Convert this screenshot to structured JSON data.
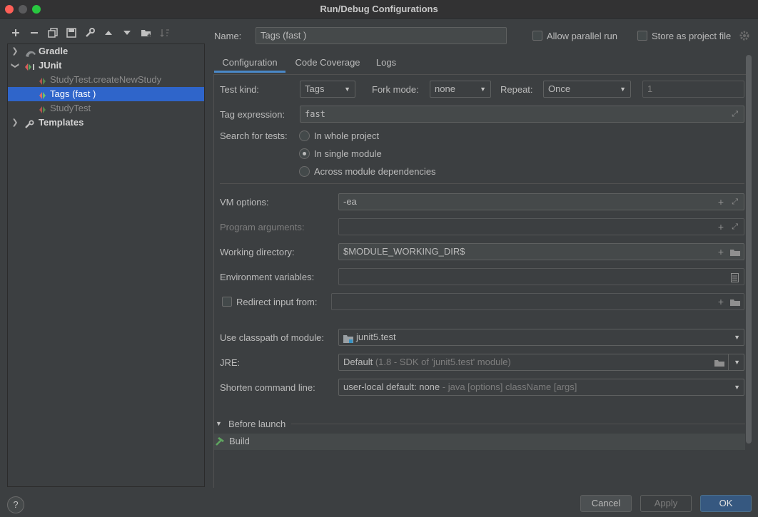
{
  "window": {
    "title": "Run/Debug Configurations"
  },
  "toolbar": {
    "icons": [
      "plus-icon",
      "minus-icon",
      "copy-icon",
      "save-icon",
      "wrench-icon",
      "arrow-up-icon",
      "arrow-down-icon",
      "folder-add-icon",
      "sort-icon"
    ]
  },
  "tree": {
    "items": [
      {
        "label": "Gradle",
        "icon": "gradle-icon",
        "expanded": false
      },
      {
        "label": "JUnit",
        "icon": "junit-icon",
        "expanded": true
      },
      {
        "label": "StudyTest.createNewStudy",
        "icon": "test-icon"
      },
      {
        "label": "Tags (fast )",
        "icon": "test-icon",
        "selected": true
      },
      {
        "label": "StudyTest",
        "icon": "test-icon"
      },
      {
        "label": "Templates",
        "icon": "wrench-icon",
        "expanded": false
      }
    ]
  },
  "header": {
    "name_label": "Name:",
    "name_value": "Tags (fast )",
    "allow_parallel": "Allow parallel run",
    "store_project": "Store as project file"
  },
  "tabs": [
    "Configuration",
    "Code Coverage",
    "Logs"
  ],
  "config": {
    "test_kind_label": "Test kind:",
    "test_kind_value": "Tags",
    "fork_mode_label": "Fork mode:",
    "fork_mode_value": "none",
    "repeat_label": "Repeat:",
    "repeat_value": "Once",
    "repeat_count": "1",
    "tag_expr_label": "Tag expression:",
    "tag_expr_value": "fast",
    "search_label": "Search for tests:",
    "search_options": [
      "In whole project",
      "In single module",
      "Across module dependencies"
    ],
    "vm_label": "VM options:",
    "vm_value": "-ea",
    "prog_args_label": "Program arguments:",
    "workdir_label": "Working directory:",
    "workdir_value": "$MODULE_WORKING_DIR$",
    "env_label": "Environment variables:",
    "redirect_label": "Redirect input from:",
    "classpath_label": "Use classpath of module:",
    "classpath_value": "junit5.test",
    "jre_label": "JRE:",
    "jre_value": "Default",
    "jre_detail": "(1.8 - SDK of 'junit5.test' module)",
    "shorten_label": "Shorten command line:",
    "shorten_value": "user-local default: none",
    "shorten_detail": "- java [options] className [args]"
  },
  "before_launch": {
    "title": "Before launch",
    "items": [
      "Build"
    ]
  },
  "buttons": {
    "cancel": "Cancel",
    "apply": "Apply",
    "ok": "OK"
  },
  "colors": {
    "selection": "#2f65ca",
    "ok_button": "#365880",
    "tab_underline": "#4a88c7"
  }
}
